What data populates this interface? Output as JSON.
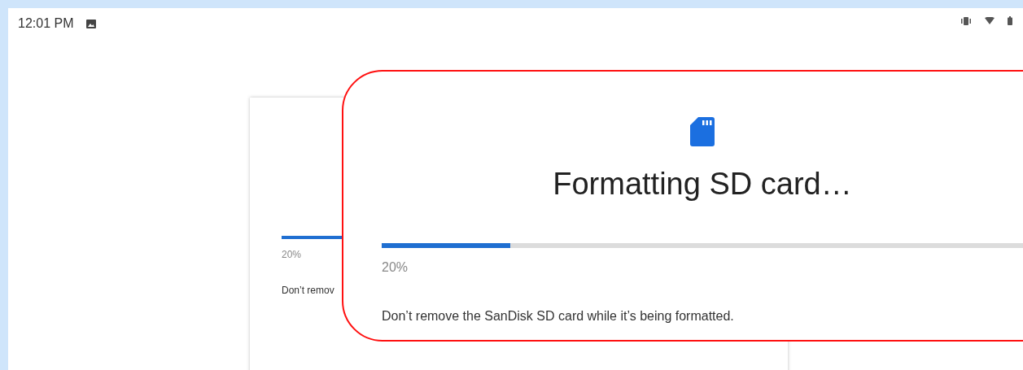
{
  "status_bar": {
    "time": "12:01 PM"
  },
  "background_dialog": {
    "progress": {
      "level": 0.2
    },
    "percent": "20%",
    "message": "Don’t remov"
  },
  "zoom_callout": {
    "title": "Formatting SD card…",
    "progress": {
      "level": 0.2
    },
    "percent": "20%",
    "message": "Don’t remove the SanDisk SD card while it’s being formatted."
  }
}
